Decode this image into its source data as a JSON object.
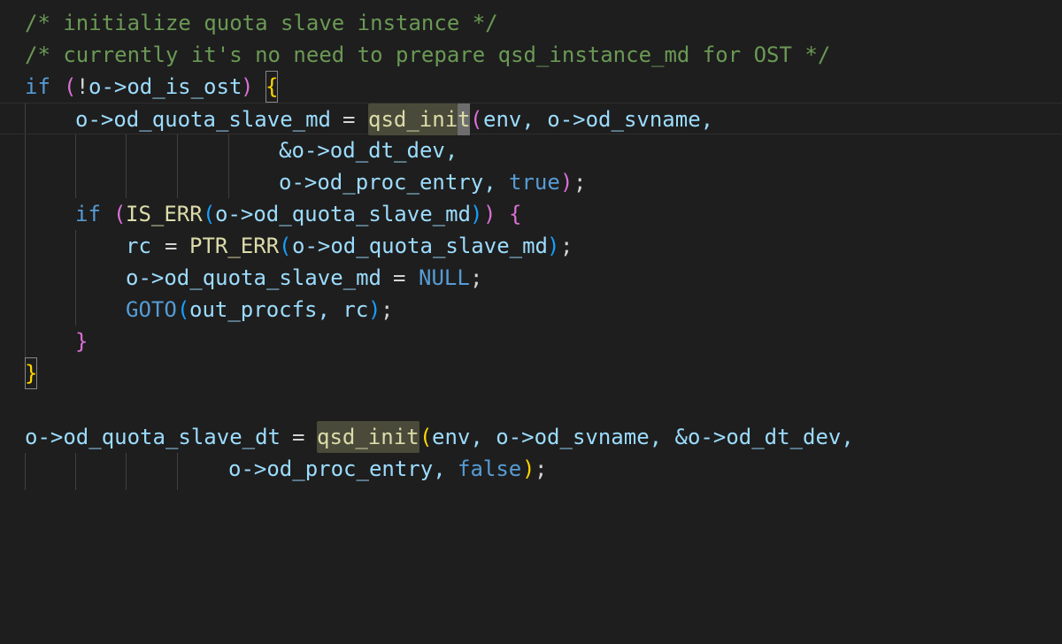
{
  "editor": {
    "lines": [
      {
        "id": "l1",
        "text": "/* initialize quota slave instance */"
      },
      {
        "id": "l2",
        "text": "/* currently it's no need to prepare qsd_instance_md for OST */"
      },
      {
        "id": "l3a",
        "text": "if"
      },
      {
        "id": "l3b",
        "text": "("
      },
      {
        "id": "l3c",
        "text": "!"
      },
      {
        "id": "l3d",
        "text": "o->od_is_ost"
      },
      {
        "id": "l3e",
        "text": ")"
      },
      {
        "id": "l3f",
        "text": "{"
      },
      {
        "id": "l4a",
        "text": "o->od_quota_slave_md"
      },
      {
        "id": "l4b",
        "text": "="
      },
      {
        "id": "l4c",
        "text": "qsd_ini"
      },
      {
        "id": "l4d",
        "text": "t"
      },
      {
        "id": "l4e",
        "text": "("
      },
      {
        "id": "l4f",
        "text": "env, o->od_svname,"
      },
      {
        "id": "l5",
        "text": "&o->od_dt_dev,"
      },
      {
        "id": "l6a",
        "text": "o->od_proc_entry,"
      },
      {
        "id": "l6b",
        "text": "true"
      },
      {
        "id": "l6c",
        "text": ")"
      },
      {
        "id": "l6d",
        "text": ";"
      },
      {
        "id": "l7a",
        "text": "if"
      },
      {
        "id": "l7b",
        "text": "("
      },
      {
        "id": "l7c",
        "text": "IS_ERR"
      },
      {
        "id": "l7d",
        "text": "("
      },
      {
        "id": "l7e",
        "text": "o->od_quota_slave_md"
      },
      {
        "id": "l7f",
        "text": ")"
      },
      {
        "id": "l7g",
        "text": ")"
      },
      {
        "id": "l7h",
        "text": "{"
      },
      {
        "id": "l8a",
        "text": "rc"
      },
      {
        "id": "l8b",
        "text": "="
      },
      {
        "id": "l8c",
        "text": "PTR_ERR"
      },
      {
        "id": "l8d",
        "text": "("
      },
      {
        "id": "l8e",
        "text": "o->od_quota_slave_md"
      },
      {
        "id": "l8f",
        "text": ")"
      },
      {
        "id": "l8g",
        "text": ";"
      },
      {
        "id": "l9a",
        "text": "o->od_quota_slave_md"
      },
      {
        "id": "l9b",
        "text": "="
      },
      {
        "id": "l9c",
        "text": "NULL"
      },
      {
        "id": "l9d",
        "text": ";"
      },
      {
        "id": "l10a",
        "text": "GOTO"
      },
      {
        "id": "l10b",
        "text": "("
      },
      {
        "id": "l10c",
        "text": "out_procfs, rc"
      },
      {
        "id": "l10d",
        "text": ")"
      },
      {
        "id": "l10e",
        "text": ";"
      },
      {
        "id": "l11",
        "text": "}"
      },
      {
        "id": "l12",
        "text": "}"
      },
      {
        "id": "l14a",
        "text": "o->od_quota_slave_dt"
      },
      {
        "id": "l14b",
        "text": "="
      },
      {
        "id": "l14c",
        "text": "qsd_init"
      },
      {
        "id": "l14d",
        "text": "("
      },
      {
        "id": "l14e",
        "text": "env, o->od_svname, &o->od_dt_dev,"
      },
      {
        "id": "l15a",
        "text": "o->od_proc_entry,"
      },
      {
        "id": "l15b",
        "text": "false"
      },
      {
        "id": "l15c",
        "text": ")"
      },
      {
        "id": "l15d",
        "text": ";"
      }
    ]
  },
  "colors": {
    "background": "#1e1e1e",
    "comment": "#6a9955",
    "keyword": "#569cd6",
    "function": "#dcdcaa",
    "variable": "#9cdcfe",
    "bracket_gold": "#ffd700",
    "bracket_orchid": "#da70d6",
    "bracket_blue": "#179fff"
  }
}
